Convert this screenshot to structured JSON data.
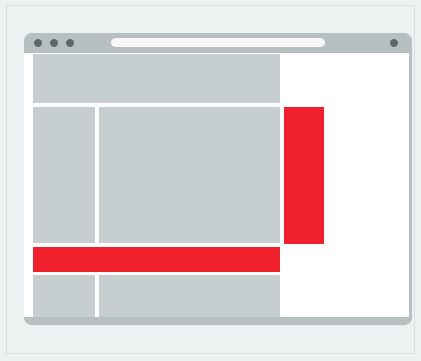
{
  "window": {
    "title": "",
    "address_bar_value": "",
    "controls": [
      "close-dot",
      "minimize-dot",
      "maximize-dot"
    ],
    "menu_icon": "menu-dot-icon"
  },
  "layout_blocks": {
    "header_block": "",
    "left_panel_block": "",
    "main_panel_block": "",
    "bottom_left_block": "",
    "bottom_right_block": "",
    "highlight_bar": "",
    "highlight_sidebar": ""
  },
  "colors": {
    "frame_background": "#edf1f2",
    "browser_chrome": "#b7c0c1",
    "content_gray": "#c7cecf",
    "accent_red": "#f0202d",
    "page_white": "#ffffff"
  }
}
